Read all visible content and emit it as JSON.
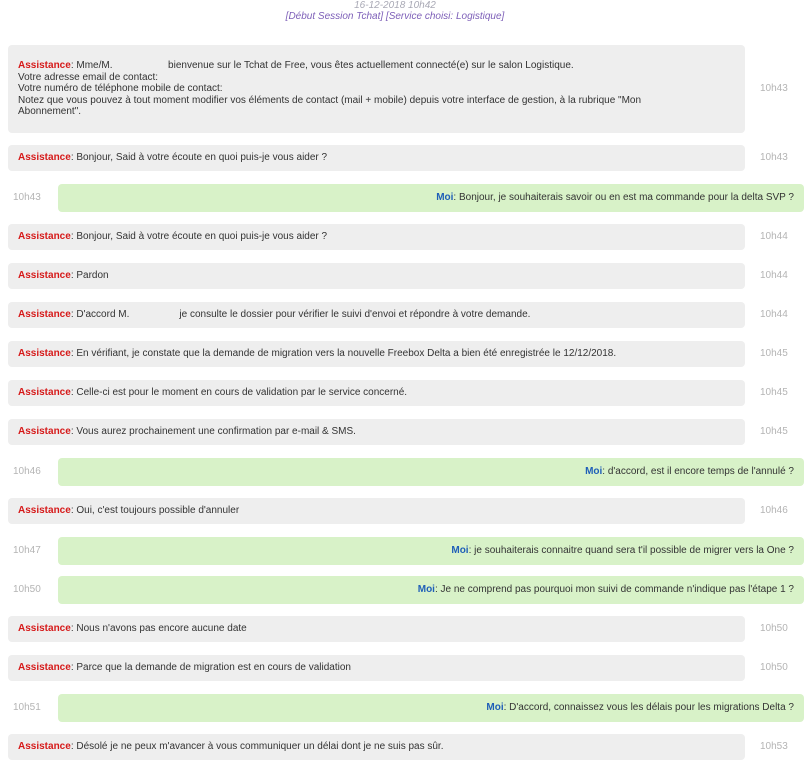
{
  "session": {
    "date": "16-12-2018 10h42",
    "info": "[Début Session Tchat] [Service choisi: Logistique]"
  },
  "messages": [
    {
      "from": "assistance",
      "sender": "Assistance",
      "lines": [
        "Mme/M.                    bienvenue sur le Tchat de Free, vous êtes actuellement connecté(e) sur le salon Logistique.",
        "Votre adresse email de contact:",
        "Votre numéro de téléphone mobile de contact:",
        "Notez que vous pouvez à tout moment modifier vos éléments de contact (mail + mobile) depuis votre interface de gestion, à la rubrique \"Mon",
        "Abonnement\"."
      ],
      "time": "10h43"
    },
    {
      "from": "assistance",
      "sender": "Assistance",
      "lines": [
        "Bonjour, Said à votre écoute en quoi puis-je vous aider ?"
      ],
      "time": "10h43"
    },
    {
      "from": "me",
      "sender": "Moi",
      "lines": [
        "Bonjour, je souhaiterais savoir ou en est ma commande pour la delta SVP ?"
      ],
      "time": "10h43"
    },
    {
      "from": "assistance",
      "sender": "Assistance",
      "lines": [
        "Bonjour, Said à votre écoute en quoi puis-je vous aider ?"
      ],
      "time": "10h44"
    },
    {
      "from": "assistance",
      "sender": "Assistance",
      "lines": [
        "Pardon"
      ],
      "time": "10h44"
    },
    {
      "from": "assistance",
      "sender": "Assistance",
      "lines": [
        "D'accord M.                  je consulte le dossier pour vérifier le suivi d'envoi et répondre à votre demande."
      ],
      "time": "10h44"
    },
    {
      "from": "assistance",
      "sender": "Assistance",
      "lines": [
        "En vérifiant, je constate que la demande de migration vers la nouvelle Freebox Delta a bien été enregistrée le 12/12/2018."
      ],
      "time": "10h45"
    },
    {
      "from": "assistance",
      "sender": "Assistance",
      "lines": [
        "Celle-ci est pour le moment en cours de validation par le service concerné."
      ],
      "time": "10h45"
    },
    {
      "from": "assistance",
      "sender": "Assistance",
      "lines": [
        "Vous aurez prochainement une confirmation par e-mail & SMS."
      ],
      "time": "10h45"
    },
    {
      "from": "me",
      "sender": "Moi",
      "lines": [
        "d'accord, est il encore temps de l'annulé ?"
      ],
      "time": "10h46"
    },
    {
      "from": "assistance",
      "sender": "Assistance",
      "lines": [
        "Oui, c'est toujours possible d'annuler"
      ],
      "time": "10h46"
    },
    {
      "from": "me",
      "sender": "Moi",
      "lines": [
        "je souhaiterais connaitre quand sera t'il possible de migrer vers la One ?"
      ],
      "time": "10h47"
    },
    {
      "from": "me",
      "sender": "Moi",
      "lines": [
        "Je ne comprend pas pourquoi mon suivi de commande n'indique pas l'étape 1 ?"
      ],
      "time": "10h50"
    },
    {
      "from": "assistance",
      "sender": "Assistance",
      "lines": [
        "Nous n'avons pas encore aucune date"
      ],
      "time": "10h50"
    },
    {
      "from": "assistance",
      "sender": "Assistance",
      "lines": [
        "Parce que la demande de migration est en cours de validation"
      ],
      "time": "10h50"
    },
    {
      "from": "me",
      "sender": "Moi",
      "lines": [
        "D'accord, connaissez vous les délais pour les migrations Delta ?"
      ],
      "time": "10h51"
    },
    {
      "from": "assistance",
      "sender": "Assistance",
      "lines": [
        "Désolé je ne peux m'avancer à vous communiquer un délai dont je ne suis pas sûr."
      ],
      "time": "10h53"
    }
  ]
}
